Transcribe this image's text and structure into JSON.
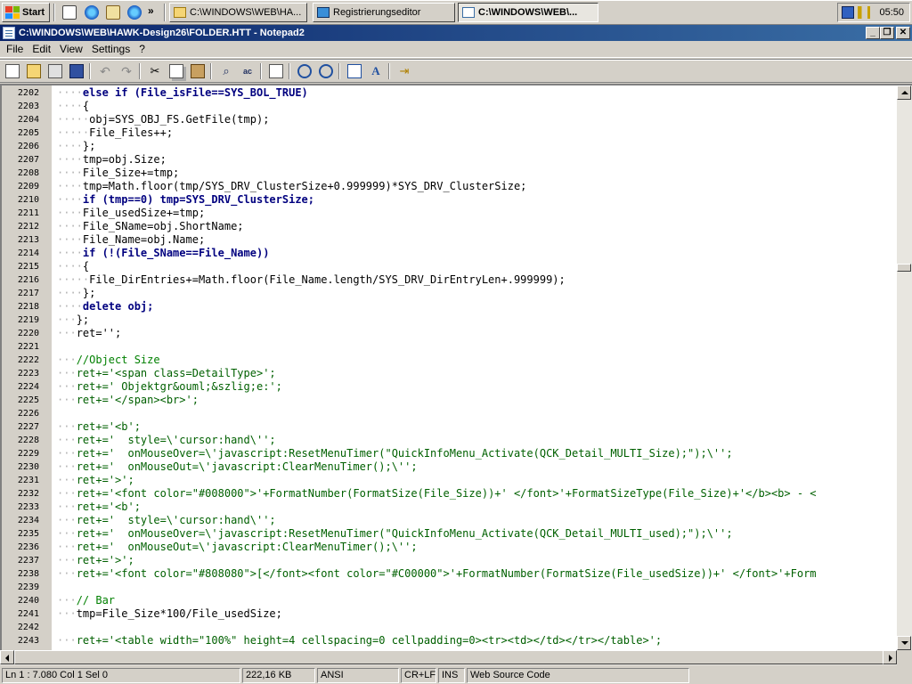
{
  "taskbar": {
    "start_label": "Start",
    "more_label": "»",
    "tasks": [
      {
        "label": "C:\\WINDOWS\\WEB\\HA..."
      },
      {
        "label": "Registrierungseditor"
      },
      {
        "label": "C:\\WINDOWS\\WEB\\..."
      }
    ],
    "clock": "05:50"
  },
  "window": {
    "title": "C:\\WINDOWS\\WEB\\HAWK-Design26\\FOLDER.HTT - Notepad2",
    "buttons": {
      "minimize": "_",
      "maximize": "❐",
      "close": "✕"
    }
  },
  "menu": {
    "items": [
      "File",
      "Edit",
      "View",
      "Settings",
      "?"
    ]
  },
  "toolbar": {
    "icons": [
      "new-file-icon",
      "open-file-icon",
      "browse-icon",
      "save-icon",
      "undo-icon",
      "redo-icon",
      "cut-icon",
      "copy-icon",
      "paste-icon",
      "find-icon",
      "replace-icon",
      "word-wrap-icon",
      "zoom-in-icon",
      "zoom-out-icon",
      "scheme-icon",
      "font-icon",
      "exit-icon"
    ]
  },
  "editor": {
    "lines": [
      {
        "n": "2202",
        "ws": "····",
        "code": "else if (File_isFile==SYS_BOL_TRUE)"
      },
      {
        "n": "2203",
        "ws": "····",
        "code": "{"
      },
      {
        "n": "2204",
        "ws": "·····",
        "code": "obj=SYS_OBJ_FS.GetFile(tmp);"
      },
      {
        "n": "2205",
        "ws": "·····",
        "code": "File_Files++;"
      },
      {
        "n": "2206",
        "ws": "····",
        "code": "};"
      },
      {
        "n": "2207",
        "ws": "····",
        "code": "tmp=obj.Size;"
      },
      {
        "n": "2208",
        "ws": "····",
        "code": "File_Size+=tmp;"
      },
      {
        "n": "2209",
        "ws": "····",
        "code": "tmp=Math.floor(tmp/SYS_DRV_ClusterSize+0.999999)*SYS_DRV_ClusterSize;"
      },
      {
        "n": "2210",
        "ws": "····",
        "code": "if (tmp==0) tmp=SYS_DRV_ClusterSize;"
      },
      {
        "n": "2211",
        "ws": "····",
        "code": "File_usedSize+=tmp;"
      },
      {
        "n": "2212",
        "ws": "····",
        "code": "File_SName=obj.ShortName;"
      },
      {
        "n": "2213",
        "ws": "····",
        "code": "File_Name=obj.Name;"
      },
      {
        "n": "2214",
        "ws": "····",
        "code": "if (!(File_SName==File_Name))"
      },
      {
        "n": "2215",
        "ws": "····",
        "code": "{"
      },
      {
        "n": "2216",
        "ws": "·····",
        "code": "File_DirEntries+=Math.floor(File_Name.length/SYS_DRV_DirEntryLen+.999999);"
      },
      {
        "n": "2217",
        "ws": "····",
        "code": "};"
      },
      {
        "n": "2218",
        "ws": "····",
        "code": "delete obj;"
      },
      {
        "n": "2219",
        "ws": "···",
        "code": "};"
      },
      {
        "n": "2220",
        "ws": "···",
        "code": "ret='';"
      },
      {
        "n": "2221",
        "ws": "",
        "code": ""
      },
      {
        "n": "2222",
        "ws": "···",
        "code": "//Object Size"
      },
      {
        "n": "2223",
        "ws": "···",
        "code": "ret+='<span class=DetailType>';"
      },
      {
        "n": "2224",
        "ws": "···",
        "code": "ret+=' Objektgr&ouml;&szlig;e:';"
      },
      {
        "n": "2225",
        "ws": "···",
        "code": "ret+='</span><br>';"
      },
      {
        "n": "2226",
        "ws": "",
        "code": ""
      },
      {
        "n": "2227",
        "ws": "···",
        "code": "ret+='<b';"
      },
      {
        "n": "2228",
        "ws": "···",
        "code": "ret+='  style=\\'cursor:hand\\'';"
      },
      {
        "n": "2229",
        "ws": "···",
        "code": "ret+='  onMouseOver=\\'javascript:ResetMenuTimer(\"QuickInfoMenu_Activate(QCK_Detail_MULTI_Size);\");\\'';"
      },
      {
        "n": "2230",
        "ws": "···",
        "code": "ret+='  onMouseOut=\\'javascript:ClearMenuTimer();\\'';"
      },
      {
        "n": "2231",
        "ws": "···",
        "code": "ret+='>';"
      },
      {
        "n": "2232",
        "ws": "···",
        "code": "ret+='<font color=\"#008000\">'+FormatNumber(FormatSize(File_Size))+' </font>'+FormatSizeType(File_Size)+'</b><b> - <"
      },
      {
        "n": "2233",
        "ws": "···",
        "code": "ret+='<b';"
      },
      {
        "n": "2234",
        "ws": "···",
        "code": "ret+='  style=\\'cursor:hand\\'';"
      },
      {
        "n": "2235",
        "ws": "···",
        "code": "ret+='  onMouseOver=\\'javascript:ResetMenuTimer(\"QuickInfoMenu_Activate(QCK_Detail_MULTI_used);\");\\'';"
      },
      {
        "n": "2236",
        "ws": "···",
        "code": "ret+='  onMouseOut=\\'javascript:ClearMenuTimer();\\'';"
      },
      {
        "n": "2237",
        "ws": "···",
        "code": "ret+='>';"
      },
      {
        "n": "2238",
        "ws": "···",
        "code": "ret+='<font color=\"#808080\">[</font><font color=\"#C00000\">'+FormatNumber(FormatSize(File_usedSize))+' </font>'+Form"
      },
      {
        "n": "2239",
        "ws": "",
        "code": ""
      },
      {
        "n": "2240",
        "ws": "···",
        "code": "// Bar"
      },
      {
        "n": "2241",
        "ws": "···",
        "code": "tmp=File_Size*100/File_usedSize;"
      },
      {
        "n": "2242",
        "ws": "",
        "code": ""
      },
      {
        "n": "2243",
        "ws": "···",
        "code": "ret+='<table width=\"100%\" height=4 cellspacing=0 cellpadding=0><tr><td></td></tr></table>';"
      }
    ]
  },
  "statusbar": {
    "position": "Ln 1 : 7.080   Col 1   Sel 0",
    "size": "222,16 KB",
    "encoding": "ANSI",
    "line_endings": "CR+LF",
    "mode": "INS",
    "scheme": "Web Source Code"
  }
}
